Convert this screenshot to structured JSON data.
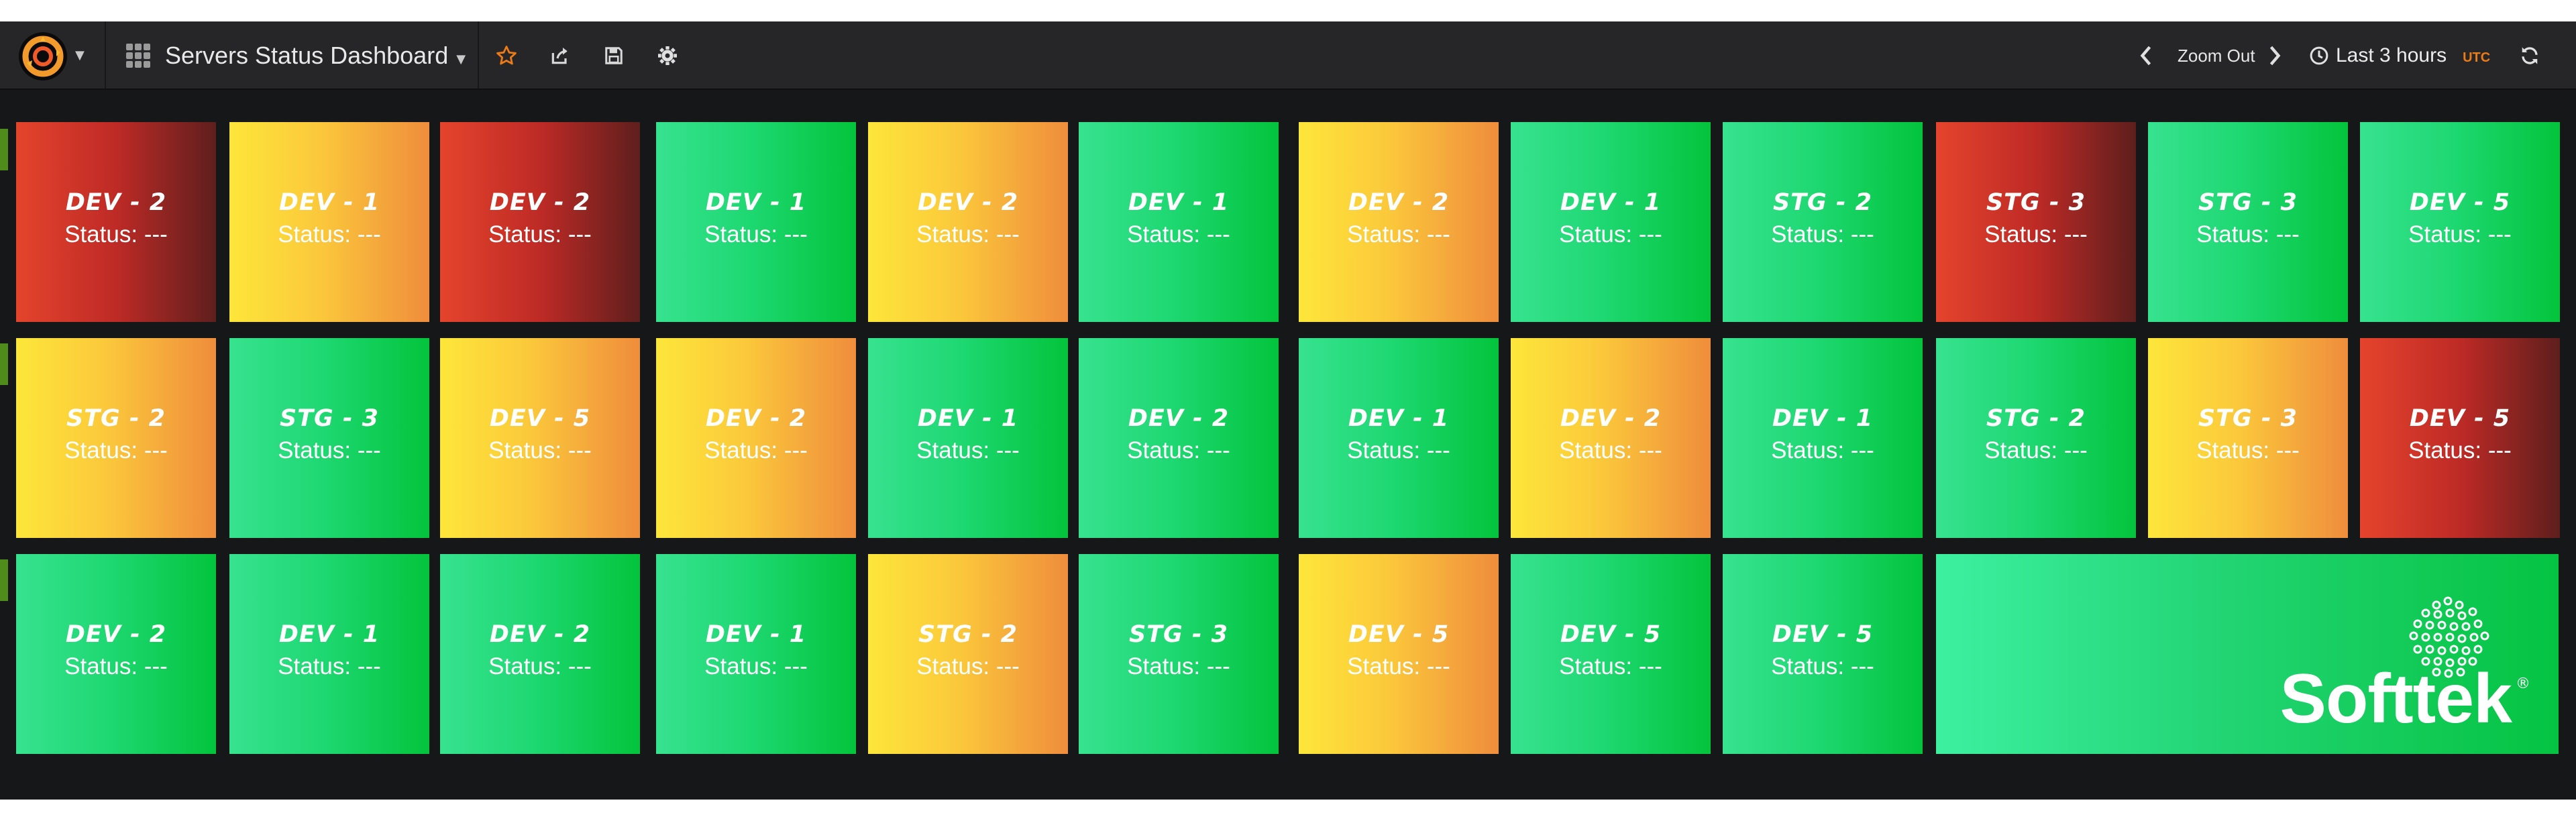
{
  "navbar": {
    "logo_icon": "grafana-logo-icon",
    "dashboard_title": "Servers Status Dashboard",
    "dashboard_icon": "dashboard-grid-icon",
    "star_icon": "star-icon",
    "share_icon": "share-icon",
    "save_icon": "save-icon",
    "settings_icon": "gear-icon",
    "zoom_out_label": "Zoom Out",
    "time_range_label": "Last 3 hours",
    "timezone_badge": "UTC",
    "refresh_icon": "refresh-icon",
    "accent_color": "#eb7b18"
  },
  "colors": {
    "green": "#03c43c",
    "yellow": "#fbc83b",
    "red": "#be2a26"
  },
  "rows": [
    [
      {
        "name": "DEV - 2",
        "status": "Status: ---",
        "state": "red"
      },
      {
        "name": "DEV - 1",
        "status": "Status: ---",
        "state": "yellow"
      },
      {
        "name": "DEV - 2",
        "status": "Status: ---",
        "state": "red"
      },
      {
        "name": "DEV - 1",
        "status": "Status: ---",
        "state": "green"
      },
      {
        "name": "DEV - 2",
        "status": "Status: ---",
        "state": "yellow"
      },
      {
        "name": "DEV - 1",
        "status": "Status: ---",
        "state": "green"
      },
      {
        "name": "DEV - 2",
        "status": "Status: ---",
        "state": "yellow"
      },
      {
        "name": "DEV - 1",
        "status": "Status: ---",
        "state": "green"
      },
      {
        "name": "STG - 2",
        "status": "Status: ---",
        "state": "green"
      },
      {
        "name": "STG - 3",
        "status": "Status: ---",
        "state": "red"
      },
      {
        "name": "STG - 3",
        "status": "Status: ---",
        "state": "green"
      },
      {
        "name": "DEV - 5",
        "status": "Status: ---",
        "state": "green"
      }
    ],
    [
      {
        "name": "STG - 2",
        "status": "Status: ---",
        "state": "yellow"
      },
      {
        "name": "STG - 3",
        "status": "Status: ---",
        "state": "green"
      },
      {
        "name": "DEV - 5",
        "status": "Status: ---",
        "state": "yellow"
      },
      {
        "name": "DEV - 2",
        "status": "Status: ---",
        "state": "yellow"
      },
      {
        "name": "DEV - 1",
        "status": "Status: ---",
        "state": "green"
      },
      {
        "name": "DEV - 2",
        "status": "Status: ---",
        "state": "green"
      },
      {
        "name": "DEV - 1",
        "status": "Status: ---",
        "state": "green"
      },
      {
        "name": "DEV - 2",
        "status": "Status: ---",
        "state": "yellow"
      },
      {
        "name": "DEV - 1",
        "status": "Status: ---",
        "state": "green"
      },
      {
        "name": "STG - 2",
        "status": "Status: ---",
        "state": "green"
      },
      {
        "name": "STG - 3",
        "status": "Status: ---",
        "state": "yellow"
      },
      {
        "name": "DEV - 5",
        "status": "Status: ---",
        "state": "red"
      }
    ],
    [
      {
        "name": "DEV - 2",
        "status": "Status: ---",
        "state": "green"
      },
      {
        "name": "DEV - 1",
        "status": "Status: ---",
        "state": "green"
      },
      {
        "name": "DEV - 2",
        "status": "Status: ---",
        "state": "green"
      },
      {
        "name": "DEV - 1",
        "status": "Status: ---",
        "state": "green"
      },
      {
        "name": "STG - 2",
        "status": "Status: ---",
        "state": "yellow"
      },
      {
        "name": "STG - 3",
        "status": "Status: ---",
        "state": "green"
      },
      {
        "name": "DEV - 5",
        "status": "Status: ---",
        "state": "yellow"
      },
      {
        "name": "DEV - 5",
        "status": "Status: ---",
        "state": "green"
      },
      {
        "name": "DEV - 5",
        "status": "Status: ---",
        "state": "green"
      }
    ]
  ],
  "branding": {
    "logo_text": "Softtek",
    "registered_mark": "®",
    "logo_icon": "softtek-dots-logo-icon"
  }
}
